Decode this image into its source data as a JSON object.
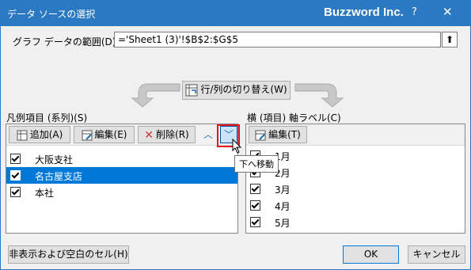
{
  "window": {
    "title": "データ ソースの選択",
    "brand": "Buzzword Inc.",
    "help": "?",
    "close": "✕"
  },
  "range": {
    "label": "グラフ データの範囲(D):",
    "value": "='Sheet1 (3)'!$B$2:$G$5",
    "collapse_glyph": "⬆"
  },
  "switch_button": {
    "label": "行/列の切り替え(W)"
  },
  "legend": {
    "title": "凡例項目 (系列)(S)",
    "add_label": "追加(A)",
    "edit_label": "編集(E)",
    "delete_label": "削除(R)",
    "up_glyph": "︿",
    "down_glyph": "﹀",
    "items": [
      "大阪支社",
      "名古屋支店",
      "本社"
    ],
    "selected_index": 1
  },
  "axis": {
    "title": "横 (項目) 軸ラベル(C)",
    "edit_label": "編集(T)",
    "items": [
      "1月",
      "2月",
      "3月",
      "4月",
      "5月"
    ]
  },
  "tooltip": "下へ移動",
  "footer": {
    "hidden_cells_label": "非表示および空白のセル(H)",
    "ok_label": "OK",
    "cancel_label": "キャンセル"
  },
  "colors": {
    "title_bar": "#2b79c2",
    "selection": "#0078d7",
    "highlight": "#e8141e"
  }
}
